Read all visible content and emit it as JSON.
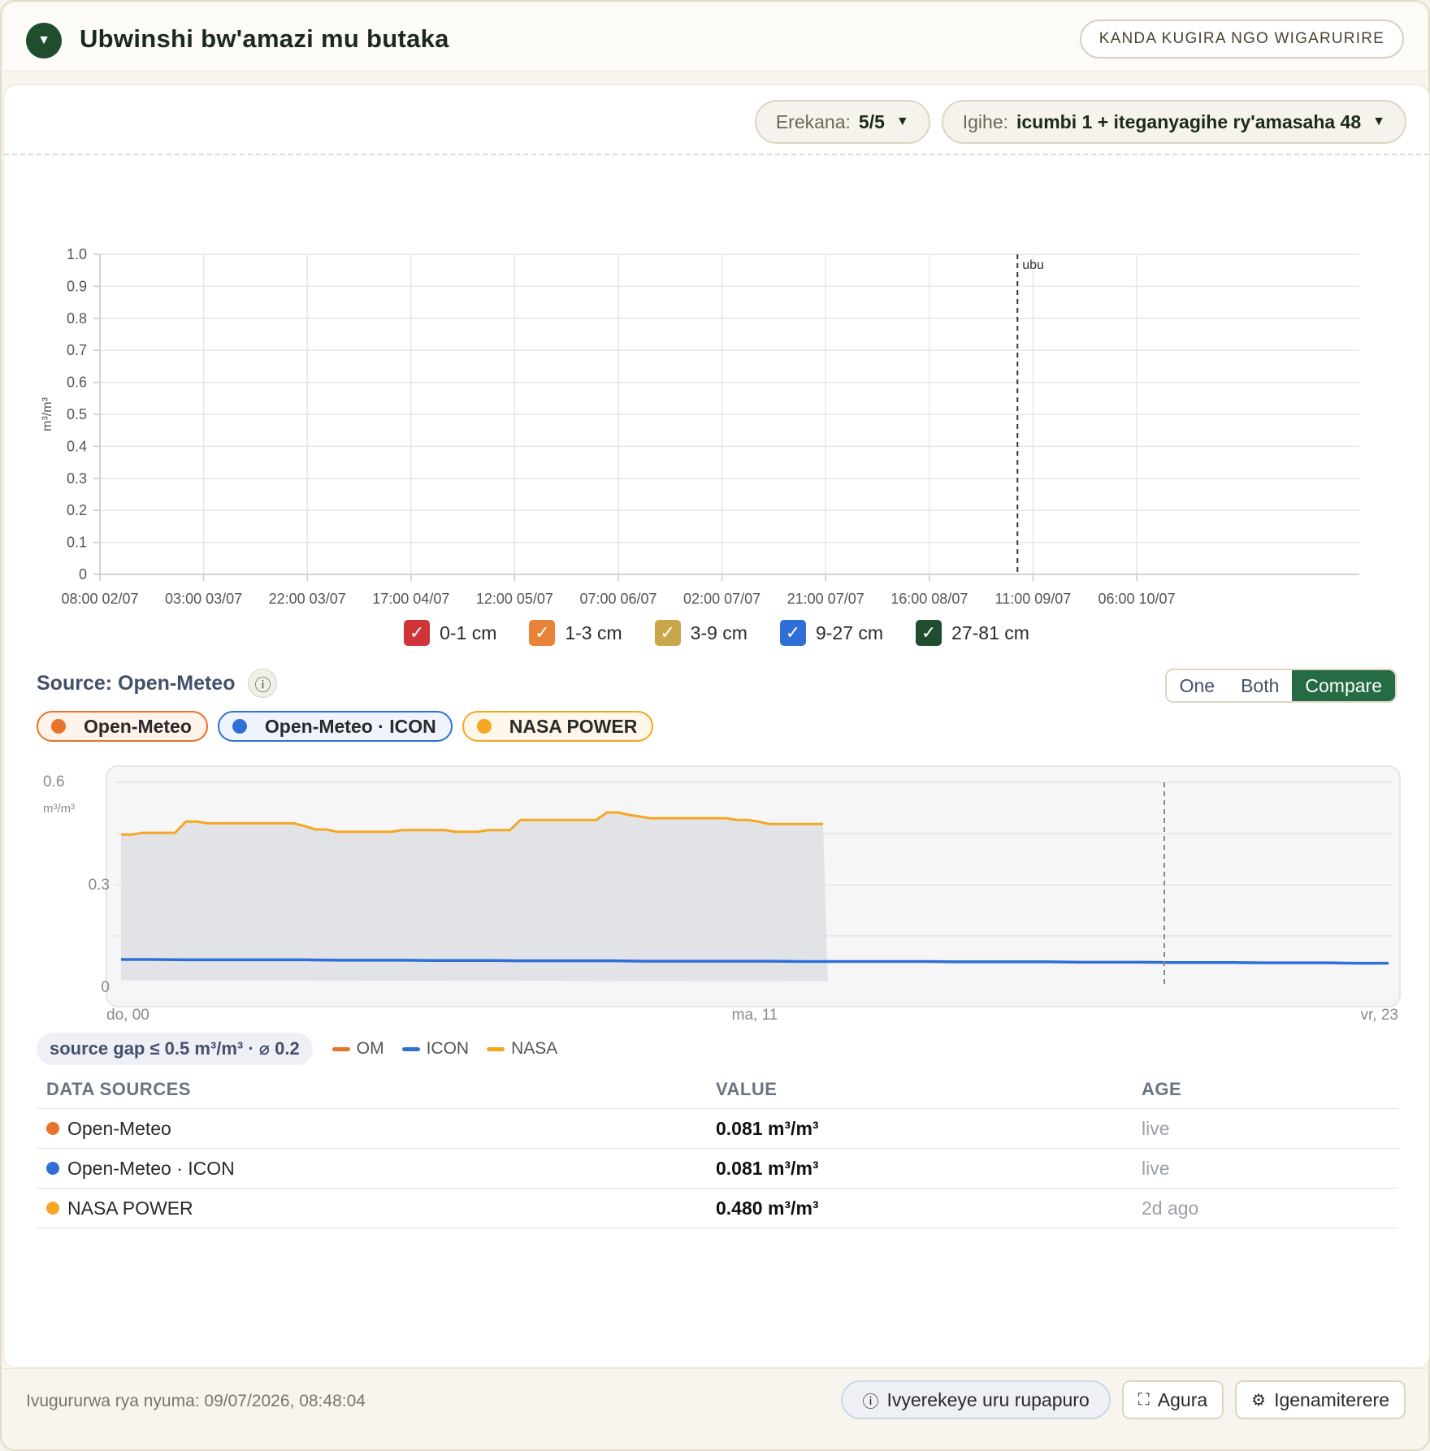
{
  "header": {
    "title": "Ubwinshi bw'amazi mu butaka",
    "action_label": "KANDA KUGIRA NGO WIGARURIRE"
  },
  "selectors": {
    "visible_label": "Erekana:",
    "visible_value": "5/5",
    "time_label": "Igihe:",
    "time_value": "icumbi 1 + iteganyagihe ry'amasaha 48"
  },
  "chart_data": [
    {
      "type": "line",
      "ylabel": "m³/m³",
      "ylim": [
        0,
        1.0
      ],
      "y_ticks": [
        "0",
        "0.1",
        "0.2",
        "0.3",
        "0.4",
        "0.5",
        "0.6",
        "0.7",
        "0.8",
        "0.9",
        "1.0"
      ],
      "categories": [
        "08:00 02/07",
        "03:00 03/07",
        "22:00 03/07",
        "17:00 04/07",
        "12:00 05/07",
        "07:00 06/07",
        "02:00 07/07",
        "21:00 07/07",
        "16:00 08/07",
        "11:00 09/07",
        "06:00 10/07"
      ],
      "now_marker_label": "ubu",
      "grid": true,
      "legend_position": "bottom",
      "series": [
        {
          "name": "0-1 cm",
          "color": "#d13438",
          "values": []
        },
        {
          "name": "1-3 cm",
          "color": "#e8833a",
          "values": []
        },
        {
          "name": "3-9 cm",
          "color": "#c9a64a",
          "values": []
        },
        {
          "name": "9-27 cm",
          "color": "#2f6fd6",
          "values": []
        },
        {
          "name": "27-81 cm",
          "color": "#1f4d2e",
          "values": []
        }
      ]
    },
    {
      "type": "line",
      "ylabel": "m³/m³",
      "ylim": [
        0,
        0.6
      ],
      "y_ticks": [
        "0",
        "0.3",
        "0.6"
      ],
      "x_ticks": [
        "do, 00",
        "ma, 11",
        "vr, 23"
      ],
      "series": [
        {
          "name": "NASA",
          "color": "#f5a623",
          "values": [
            0.447,
            0.447,
            0.452,
            0.452,
            0.452,
            0.452,
            0.485,
            0.485,
            0.48,
            0.48,
            0.48,
            0.48,
            0.48,
            0.48,
            0.48,
            0.48,
            0.48,
            0.472,
            0.462,
            0.462,
            0.455,
            0.455,
            0.455,
            0.455,
            0.455,
            0.455,
            0.46,
            0.46,
            0.46,
            0.46,
            0.46,
            0.455,
            0.455,
            0.455,
            0.46,
            0.46,
            0.46,
            0.49,
            0.49,
            0.49,
            0.49,
            0.49,
            0.49,
            0.49,
            0.49,
            0.512,
            0.512,
            0.505,
            0.5,
            0.495,
            0.495,
            0.495,
            0.495,
            0.495,
            0.495,
            0.495,
            0.495,
            0.49,
            0.49,
            0.485,
            0.478,
            0.478,
            0.478,
            0.478,
            0.478,
            0.478
          ]
        },
        {
          "name": "ICON",
          "color": "#2f6fd6",
          "values": [
            0.081,
            0.081,
            0.08,
            0.08,
            0.08,
            0.08,
            0.08,
            0.079,
            0.079,
            0.079,
            0.078,
            0.078,
            0.078,
            0.077,
            0.077,
            0.077,
            0.077,
            0.076,
            0.076,
            0.076,
            0.076,
            0.076,
            0.075,
            0.075,
            0.075,
            0.075,
            0.075,
            0.074,
            0.074,
            0.074,
            0.074,
            0.073,
            0.073,
            0.073,
            0.072,
            0.072,
            0.072,
            0.071,
            0.071,
            0.071,
            0.07,
            0.07
          ]
        }
      ]
    }
  ],
  "legend": [
    {
      "label": "0-1 cm",
      "color": "#d13438"
    },
    {
      "label": "1-3 cm",
      "color": "#e8833a"
    },
    {
      "label": "3-9 cm",
      "color": "#c9a64a"
    },
    {
      "label": "9-27 cm",
      "color": "#2f6fd6"
    },
    {
      "label": "27-81 cm",
      "color": "#1f4d2e"
    }
  ],
  "source": {
    "label": "Source: Open-Meteo",
    "modes": [
      "One",
      "Both",
      "Compare"
    ],
    "active_mode": "Compare"
  },
  "chips": [
    {
      "label": "Open-Meteo",
      "color": "#e8732a",
      "bg": "#fff3ea"
    },
    {
      "label": "Open-Meteo · ICON",
      "color": "#2f6fd6",
      "bg": "#eef3fd"
    },
    {
      "label": "NASA POWER",
      "color": "#f5a623",
      "bg": "#fff8ea"
    }
  ],
  "gap": {
    "badge": "source gap ≤ 0.5 m³/m³ · ⌀ 0.2",
    "legend": [
      {
        "label": "OM",
        "color": "#e8732a"
      },
      {
        "label": "ICON",
        "color": "#2f6fd6"
      },
      {
        "label": "NASA",
        "color": "#f5a623"
      }
    ]
  },
  "table": {
    "headers": [
      "DATA SOURCES",
      "VALUE",
      "AGE"
    ],
    "rows": [
      {
        "source": "Open-Meteo",
        "color": "#e8732a",
        "value": "0.081 m³/m³",
        "age": "live"
      },
      {
        "source": "Open-Meteo · ICON",
        "color": "#2f6fd6",
        "value": "0.081 m³/m³",
        "age": "live"
      },
      {
        "source": "NASA POWER",
        "color": "#f5a623",
        "value": "0.480 m³/m³",
        "age": "2d ago"
      }
    ]
  },
  "footer": {
    "last_updated": "Ivugururwa rya nyuma: 09/07/2026, 08:48:04",
    "info_label": "Ivyerekeye uru rupapuro",
    "close_label": "Agura",
    "settings_label": "Igenamiterere"
  }
}
